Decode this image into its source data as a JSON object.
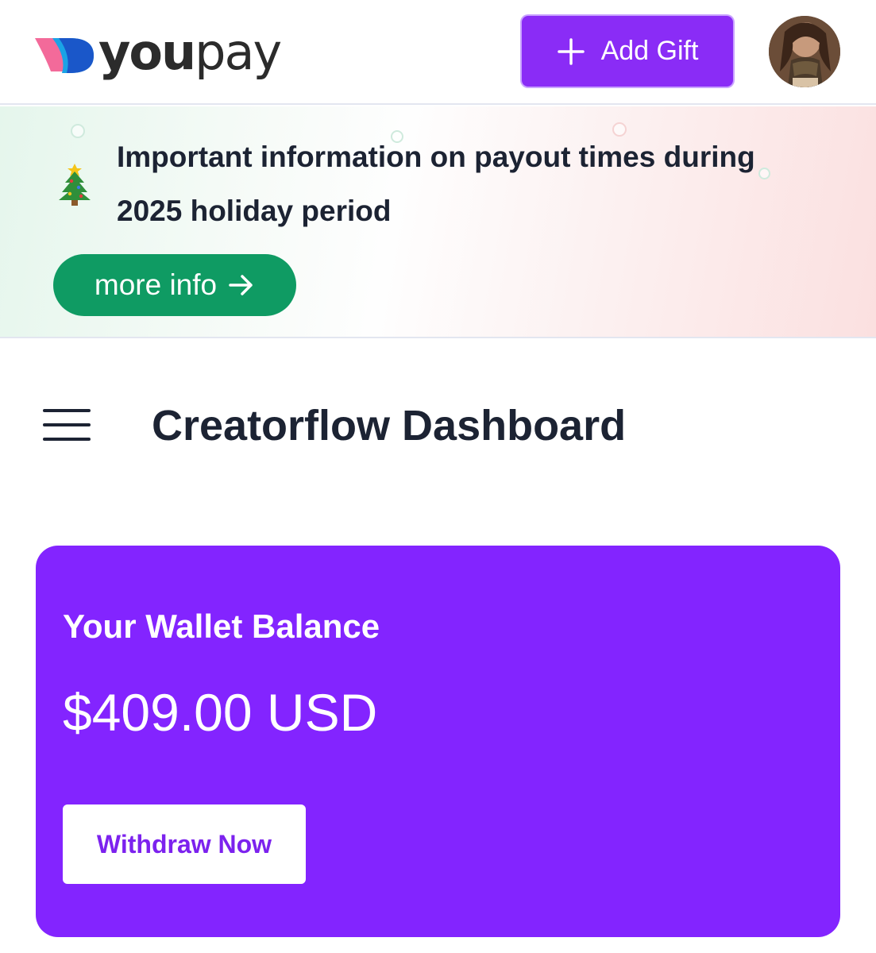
{
  "header": {
    "logo": {
      "text_bold": "you",
      "text_regular": "pay"
    },
    "add_gift_label": "Add Gift",
    "add_gift_icon": "plus-icon",
    "avatar_icon": "user-avatar"
  },
  "banner": {
    "icon": "christmas-tree-icon",
    "message": "Important information on payout times during 2025 holiday period",
    "button_label": "more info",
    "button_icon": "arrow-right-icon",
    "button_color": "#0f9b63"
  },
  "dashboard": {
    "menu_icon": "hamburger-menu-icon",
    "title": "Creatorflow Dashboard"
  },
  "wallet": {
    "label": "Your Wallet Balance",
    "amount": "$409.00 USD",
    "withdraw_label": "Withdraw Now",
    "card_color": "#8324ff"
  },
  "colors": {
    "accent": "#8a2cf6",
    "text_dark": "#1c2333"
  }
}
